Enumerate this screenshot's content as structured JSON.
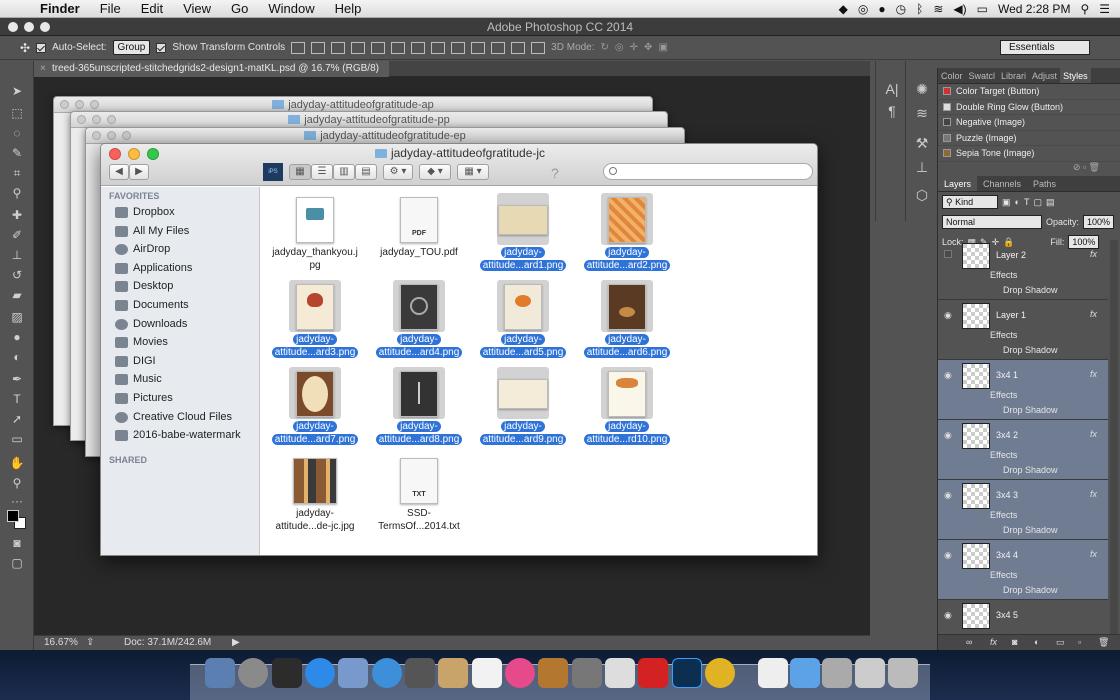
{
  "menubar": {
    "app": "Finder",
    "items": [
      "File",
      "Edit",
      "View",
      "Go",
      "Window",
      "Help"
    ],
    "clock": "Wed 2:28 PM"
  },
  "ps": {
    "title": "Adobe Photoshop CC 2014",
    "options": {
      "auto_select_label": "Auto-Select:",
      "auto_select_value": "Group",
      "transform_label": "Show Transform Controls",
      "mode3d_label": "3D Mode:",
      "workspace": "Essentials"
    },
    "doc_tab": "treed-365unscripted-stitchedgrids2-design1-matKL.psd @ 16.7% (RGB/8)",
    "status": {
      "zoom": "16.67%",
      "doc": "Doc: 37.1M/242.6M"
    }
  },
  "styles_panel": {
    "tabs": [
      "Color",
      "Swatcl",
      "Librari",
      "Adjust",
      "Styles"
    ],
    "active_tab": "Styles",
    "items": [
      "Color Target (Button)",
      "Double Ring Glow (Button)",
      "Negative (Image)",
      "Puzzle (Image)",
      "Sepia Tone (Image)"
    ]
  },
  "layers_panel": {
    "tabs": [
      "Layers",
      "Channels",
      "Paths"
    ],
    "kind_label": "Kind",
    "blend_mode": "Normal",
    "opacity_label": "Opacity:",
    "opacity": "100%",
    "lock_label": "Lock:",
    "fill_label": "Fill:",
    "fill": "100%",
    "effects_label": "Effects",
    "drop_shadow_label": "Drop Shadow",
    "fx_label": "fx",
    "layers": [
      {
        "name": "Layer 2",
        "selected": false,
        "visible": false
      },
      {
        "name": "Layer 1",
        "selected": false,
        "visible": true
      },
      {
        "name": "3x4 1",
        "selected": true,
        "visible": true
      },
      {
        "name": "3x4 2",
        "selected": true,
        "visible": true
      },
      {
        "name": "3x4 3",
        "selected": true,
        "visible": true
      },
      {
        "name": "3x4 4",
        "selected": true,
        "visible": true
      },
      {
        "name": "3x4 5",
        "selected": false,
        "visible": true
      }
    ]
  },
  "finder": {
    "back_windows": [
      "jadyday-attitudeofgratitude-ap",
      "jadyday-attitudeofgratitude-pp",
      "jadyday-attitudeofgratitude-ep"
    ],
    "title": "jadyday-attitudeofgratitude-jc",
    "sidebar": {
      "favorites_label": "FAVORITES",
      "shared_label": "SHARED",
      "items": [
        "Dropbox",
        "All My Files",
        "AirDrop",
        "Applications",
        "Desktop",
        "Documents",
        "Downloads",
        "Movies",
        "DIGI",
        "Music",
        "Pictures",
        "Creative Cloud Files",
        "2016-babe-watermark"
      ]
    },
    "files": [
      {
        "name1": "jadyday_thankyou.j",
        "name2": "pg",
        "selected": false,
        "kind": "img-white",
        "tag": ""
      },
      {
        "name1": "jadyday_TOU.pdf",
        "name2": "",
        "selected": false,
        "kind": "doc",
        "tag": "PDF"
      },
      {
        "name1": "jadyday-",
        "name2": "attitude...ard1.png",
        "selected": true,
        "kind": "img-land",
        "tag": ""
      },
      {
        "name1": "jadyday-",
        "name2": "attitude...ard2.png",
        "selected": true,
        "kind": "img-orange",
        "tag": ""
      },
      {
        "name1": "jadyday-",
        "name2": "attitude...ard3.png",
        "selected": true,
        "kind": "img-heart",
        "tag": ""
      },
      {
        "name1": "jadyday-",
        "name2": "attitude...ard4.png",
        "selected": true,
        "kind": "img-dark",
        "tag": ""
      },
      {
        "name1": "jadyday-",
        "name2": "attitude...ard5.png",
        "selected": true,
        "kind": "img-pumpkin",
        "tag": ""
      },
      {
        "name1": "jadyday-",
        "name2": "attitude...ard6.png",
        "selected": true,
        "kind": "img-brown",
        "tag": ""
      },
      {
        "name1": "jadyday-",
        "name2": "attitude...ard7.png",
        "selected": true,
        "kind": "img-oval",
        "tag": ""
      },
      {
        "name1": "jadyday-",
        "name2": "attitude...ard8.png",
        "selected": true,
        "kind": "img-dark2",
        "tag": ""
      },
      {
        "name1": "jadyday-",
        "name2": "attitude...ard9.png",
        "selected": true,
        "kind": "img-land2",
        "tag": ""
      },
      {
        "name1": "jadyday-",
        "name2": "attitude...rd10.png",
        "selected": true,
        "kind": "img-white2",
        "tag": ""
      },
      {
        "name1": "jadyday-",
        "name2": "attitude...de-jc.jpg",
        "selected": false,
        "kind": "img-collage",
        "tag": ""
      },
      {
        "name1": "SSD-",
        "name2": "TermsOf...2014.txt",
        "selected": false,
        "kind": "doc",
        "tag": "TXT"
      }
    ]
  },
  "colors": {
    "selection": "#2f73d8",
    "layer_selected": "#6f7c92",
    "ps_panel": "#535353"
  }
}
